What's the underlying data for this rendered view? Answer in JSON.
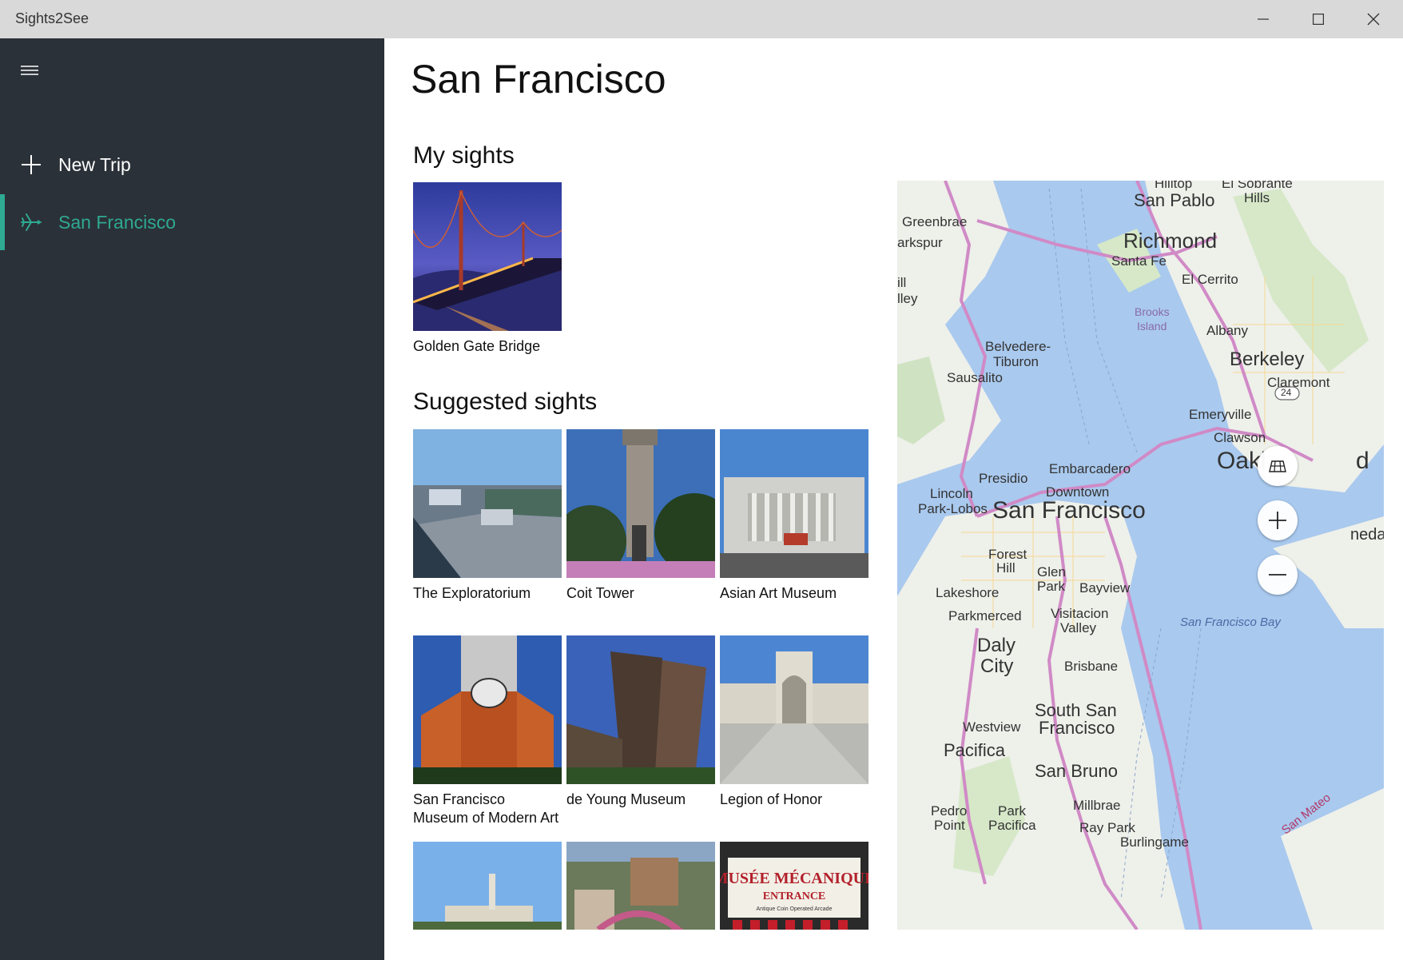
{
  "app": {
    "title": "Sights2See"
  },
  "window_controls": {
    "minimize": "minimize",
    "maximize": "maximize",
    "close": "close"
  },
  "sidebar": {
    "menu_icon": "hamburger-icon",
    "items": [
      {
        "label": "New Trip",
        "icon": "plus-icon",
        "selected": false
      },
      {
        "label": "San Francisco",
        "icon": "airplane-icon",
        "selected": true
      }
    ],
    "accent_color": "#2ea992",
    "background": "#2b3138"
  },
  "page": {
    "title": "San Francisco",
    "my_sights": {
      "heading": "My sights",
      "items": [
        {
          "name": "Golden Gate Bridge"
        }
      ]
    },
    "suggested_sights": {
      "heading": "Suggested sights",
      "items": [
        {
          "name": "The Exploratorium"
        },
        {
          "name": "Coit Tower"
        },
        {
          "name": "Asian Art Museum"
        },
        {
          "name": "San Francisco Museum of Modern Art"
        },
        {
          "name": "de Young Museum"
        },
        {
          "name": "Legion of Honor"
        },
        {
          "name": ""
        },
        {
          "name": ""
        },
        {
          "name": ""
        }
      ],
      "partial_thumbnail_text": {
        "line1": "MUSÉE MÉCANIQUE",
        "line2": "ENTRANCE",
        "line3": "Antique Coin Operated Arcade"
      }
    }
  },
  "map": {
    "controls": {
      "style": "map-style-icon",
      "zoom_in": "zoom-in-icon",
      "zoom_out": "zoom-out-icon"
    },
    "labels": {
      "hilltop": "Hilltop",
      "el_sobrante": "El Sobrante",
      "hills": "Hills",
      "san_pablo": "San Pablo",
      "greenbrae": "Greenbrae",
      "richmond": "Richmond",
      "santa_fe": "Santa Fe",
      "arkspur": "arkspur",
      "el_cerrito": "El Cerrito",
      "ill": "ill",
      "lley": "lley",
      "brooks": "Brooks",
      "island": "Island",
      "albany": "Albany",
      "belvedere": "Belvedere-",
      "tiburon": "Tiburon",
      "berkeley": "Berkeley",
      "sausalito": "Sausalito",
      "claremont": "Claremont",
      "route_24": "24",
      "emeryville": "Emeryville",
      "clawson": "Clawson",
      "embarcadero": "Embarcadero",
      "presidio": "Presidio",
      "oakland": "Oakl",
      "oakland_end": "d",
      "downtown": "Downtown",
      "lincoln": "Lincoln",
      "park_lobos": "Park-Lobos",
      "san_francisco": "San Francisco",
      "alameda": "neda",
      "forest": "Forest",
      "hill": "Hill",
      "glen": "Glen",
      "park": "Park",
      "bayview": "Bayview",
      "lakeshore": "Lakeshore",
      "parkmerced": "Parkmerced",
      "visitacion": "Visitacion",
      "valley": "Valley",
      "sf_bay": "San Francisco Bay",
      "daly": "Daly",
      "city": "City",
      "brisbane": "Brisbane",
      "south_san": "South San",
      "francisco": "Francisco",
      "westview": "Westview",
      "pacifica": "Pacifica",
      "san_bruno": "San Bruno",
      "millbrae": "Millbrae",
      "pedro": "Pedro",
      "point": "Point",
      "park2": "Park",
      "pacifica2": "Pacifica",
      "ray_park": "Ray Park",
      "burlingame": "Burlingame",
      "san_mateo": "San Mateo"
    }
  }
}
